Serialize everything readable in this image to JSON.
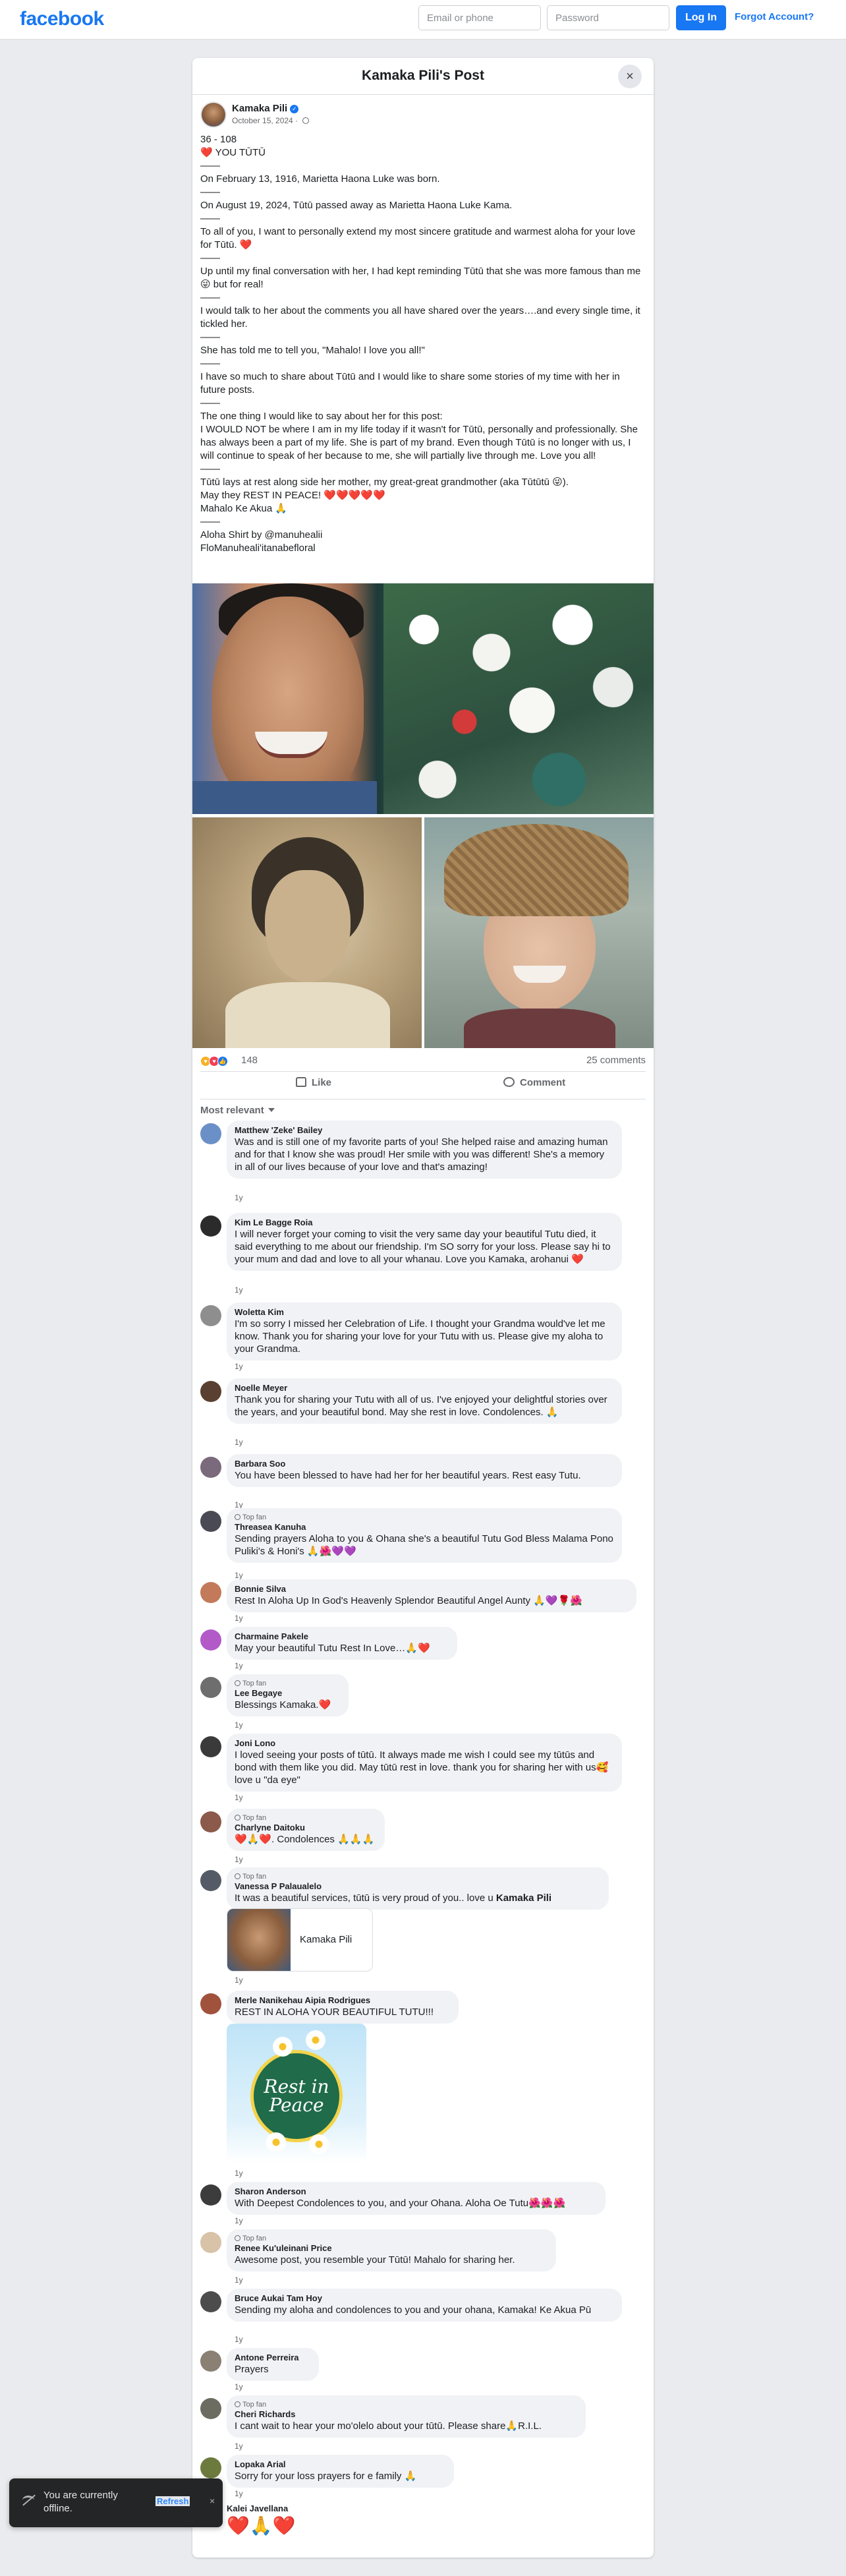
{
  "topbar": {
    "logo": "facebook",
    "email_placeholder": "Email or phone",
    "password_placeholder": "Password",
    "login_label": "Log In",
    "forgot_label": "Forgot Account?"
  },
  "post": {
    "title": "Kamaka Pili's Post",
    "close_icon": "×",
    "author": "Kamaka Pili",
    "date": "October 15, 2024",
    "text": "36 - 108\n❤️ YOU TŪTŪ\n——\nOn February 13, 1916, Marietta Haona Luke was born.\n——\nOn August 19, 2024, Tūtū passed away as Marietta Haona Luke Kama.\n——\nTo all of you, I want to personally extend my most sincere gratitude and warmest aloha for your love for Tūtū. ❤️\n——\nUp until my final conversation with her, I had kept reminding Tūtū that she was more famous than me 😜 but for real!\n——\nI would talk to her about the comments you all have shared over the years….and every single time, it tickled her.\n——\nShe has told me to tell you, \"Mahalo!  I love you all!\"\n——\nI have so much to share about Tūtū and I would like to share some stories of my time with her in future posts.\n——\nThe one thing I would like to say about her for this post:\nI WOULD NOT be where I am in my life today if it wasn't for Tūtū, personally and professionally. She has always been a part of my life. She is part of my brand.  Even though Tūtū is no longer with us, I will continue to speak of her because to me, she will partially live through me. Love you all!\n——\nTūtū lays at rest along side her mother, my great-great grandmother (aka Tūtūtū 😜).\nMay they REST IN PEACE! ❤️❤️❤️❤️❤️\nMahalo Ke Akua 🙏\n——\nAloha Shirt by @manuhealii\nFloManuheali'itanabefloral",
    "reaction_count": "148",
    "comment_count": "25 comments",
    "like_label": "Like",
    "comment_label": "Comment",
    "sort_label": "Most relevant"
  },
  "comments": [
    {
      "name": "Matthew 'Zeke' Bailey",
      "text": "Was and is still one of my favorite parts of you! She helped raise and amazing human and for that I know she was proud! Her smile with you was different! She's a memory in all of our lives because of your love and that's amazing!",
      "time": "1y"
    },
    {
      "name": "Kim Le Bagge Roia",
      "text": "I will never forget your coming to visit the very same day your beautiful Tutu died, it said everything to me about our friendship. I'm SO sorry for your loss. Please say hi to your mum and dad and love to all your whanau. Love you Kamaka, arohanui ❤️",
      "time": "1y"
    },
    {
      "name": "Woletta Kim",
      "text": "I'm so sorry I missed her Celebration of Life. I thought your Grandma would've let me know. Thank you for sharing your love for your Tutu with us. Please give my aloha to your Grandma.",
      "time": "1y"
    },
    {
      "name": "Noelle Meyer",
      "text": "Thank you for sharing your Tutu with all of us. I've enjoyed your delightful stories over the years, and your beautiful bond. May she rest in love. Condolences. 🙏",
      "time": "1y"
    },
    {
      "name": "Barbara Soo",
      "text": "You have been blessed to have had her for her beautiful years. Rest easy Tutu.",
      "time": "1y"
    },
    {
      "badge": "Top fan",
      "name": "Threasea Kanuha",
      "text": "Sending prayers Aloha to you & Ohana she's a beautiful Tutu God Bless Malama Pono Puliki's & Honi's 🙏🌺💜💜",
      "time": "1y"
    },
    {
      "name": "Bonnie Silva",
      "text": "Rest In Aloha Up In God's Heavenly Splendor Beautiful Angel Aunty 🙏💜🌹🌺",
      "time": "1y"
    },
    {
      "name": "Charmaine Pakele",
      "text": "May your beautiful Tutu Rest In Love…🙏❤️",
      "time": "1y"
    },
    {
      "badge": "Top fan",
      "name": "Lee Begaye",
      "text": "Blessings Kamaka.❤️",
      "time": "1y"
    },
    {
      "name": "Joni Lono",
      "text": "I loved seeing your posts of tūtū. It always made me wish I could see my tūtūs and bond with them like you did. May tūtū rest in love. thank you for sharing her with us🥰 love u \"da eye\"",
      "time": "1y"
    },
    {
      "badge": "Top fan",
      "name": "Charlyne Daitoku",
      "text": "❤️🙏❤️. Condolences 🙏🙏🙏",
      "time": "1y"
    },
    {
      "badge": "Top fan",
      "name": "Vanessa P Palaualelo",
      "text": "It was a beautiful services, tūtū is very proud of you.. love u ",
      "mention": "Kamaka Pili",
      "card_name": "Kamaka Pili",
      "time": "1y"
    },
    {
      "name": "Merle Nanikehau Aipia Rodrigues",
      "text": "REST IN ALOHA YOUR BEAUTIFUL TUTU!!!",
      "sticker_text": "Rest in Peace",
      "time": "1y"
    },
    {
      "name": "Sharon Anderson",
      "text": "With Deepest Condolences to you, and your Ohana. Aloha Oe Tutu🌺🌺🌺",
      "time": "1y"
    },
    {
      "badge": "Top fan",
      "name": "Renee Ku'uleinani Price",
      "text": "Awesome post, you resemble your Tūtū! Mahalo for sharing her.",
      "time": "1y"
    },
    {
      "name": "Bruce Aukai Tam Hoy",
      "text": "Sending my aloha and condolences to you and your ohana, Kamaka! Ke Akua Pū",
      "time": "1y"
    },
    {
      "name": "Antone Perreira",
      "text": "Prayers",
      "time": "1y"
    },
    {
      "badge": "Top fan",
      "name": "Cheri Richards",
      "text": "I cant wait to hear your mo'olelo about your tūtū. Please share🙏R.I.L.",
      "time": "1y"
    },
    {
      "name": "Lopaka Arial",
      "text": "Sorry for your loss prayers for e family 🙏",
      "time": "1y"
    },
    {
      "name": "Kalei Javellana",
      "text": "❤️🙏❤️",
      "time": ""
    }
  ],
  "toast": {
    "text": "You are currently offline.",
    "refresh": "Refresh",
    "close": "×"
  },
  "colors": {
    "brand": "#1877f2",
    "background": "#e9ebee",
    "bubble": "#f0f2f5"
  }
}
